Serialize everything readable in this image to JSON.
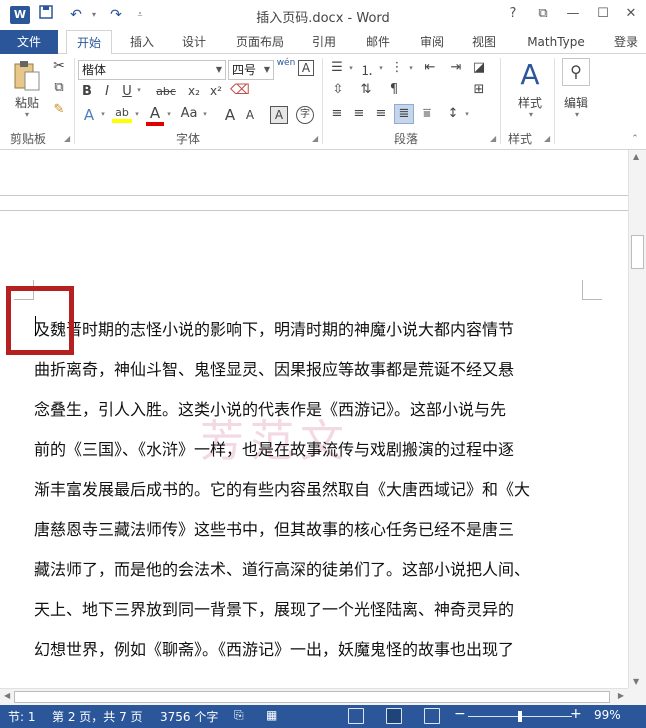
{
  "window": {
    "title": "插入页码.docx - Word",
    "app_icon": "W",
    "quick_access": [
      "save-icon",
      "undo-icon",
      "redo-icon",
      "customize-icon"
    ],
    "controls": [
      "?",
      "⧉",
      "—",
      "☐",
      "✕"
    ]
  },
  "tabs": {
    "file": "文件",
    "items": [
      "开始",
      "插入",
      "设计",
      "页面布局",
      "引用",
      "邮件",
      "审阅",
      "视图",
      "MathType",
      "登录"
    ],
    "active": "开始"
  },
  "ribbon": {
    "clipboard": {
      "paste": "粘贴",
      "label": "剪贴板"
    },
    "font": {
      "name": "楷体",
      "size": "四号",
      "label": "字体",
      "row2": [
        "B",
        "I",
        "U",
        "abc",
        "x₂",
        "x²"
      ],
      "row3": [
        "A",
        "ab",
        "A",
        "Aa",
        "A",
        "A",
        "A",
        "字"
      ]
    },
    "paragraph": {
      "label": "段落"
    },
    "styles": {
      "button": "样式",
      "label": "样式"
    },
    "editing": {
      "button": "编辑"
    }
  },
  "document": {
    "lines": [
      "及魏晋时期的志怪小说的影响下，明清时期的神魔小说大都内容情节",
      "曲折离奇，神仙斗智、鬼怪显灵、因果报应等故事都是荒诞不经又悬",
      "念叠生，引人入胜。这类小说的代表作是《西游记》。这部小说与先",
      "前的《三国》、《水浒》一样，也是在故事流传与戏剧搬演的过程中逐",
      "渐丰富发展最后成书的。它的有些内容虽然取自《大唐西域记》和《大",
      "唐慈恩寺三藏法师传》这些书中，但其故事的核心任务已经不是唐三",
      "藏法师了，而是他的会法术、道行高深的徒弟们了。这部小说把人间、",
      "天上、地下三界放到同一背景下，展现了一个光怪陆离、神奇灵异的",
      "幻想世界，例如《聊斋》。《西游记》一出，妖魔鬼怪的故事也出现了"
    ],
    "watermark": "芳范文"
  },
  "status": {
    "section": "节: 1",
    "page": "第 2 页，共 7 页",
    "words": "3756 个字",
    "zoom": "99%",
    "zoom_minus": "−",
    "zoom_plus": "+",
    "zoom_fraction": 0.5
  }
}
